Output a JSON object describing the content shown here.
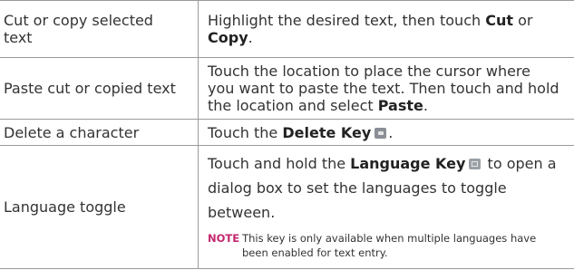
{
  "table": {
    "rows": [
      {
        "action": "Cut or copy selected text",
        "desc_before": "Highlight the desired text, then touch ",
        "bold1": "Cut",
        "desc_mid": " or ",
        "bold2": "Copy",
        "desc_after": "."
      },
      {
        "action": "Paste cut or copied text",
        "desc_before": "Touch the location to place the cursor where you want to paste the text. Then touch and hold the location and select ",
        "bold1": "Paste",
        "desc_after": "."
      },
      {
        "action": "Delete a character",
        "desc_before": "Touch the ",
        "bold1": "Delete Key",
        "icon": "delete-key-icon",
        "desc_after": "."
      },
      {
        "action": "Language toggle",
        "desc_before": "Touch and hold the ",
        "bold1": "Language Key",
        "icon": "language-key-icon",
        "desc_after": " to open a dialog box to set the languages to toggle between.",
        "note_label": "NOTE",
        "note_line1": "This key is only available when multiple languages have",
        "note_line2": "been enabled for text entry."
      }
    ]
  },
  "colors": {
    "border": "#9a9a9a",
    "text": "#333333",
    "note_label": "#c4266d"
  }
}
